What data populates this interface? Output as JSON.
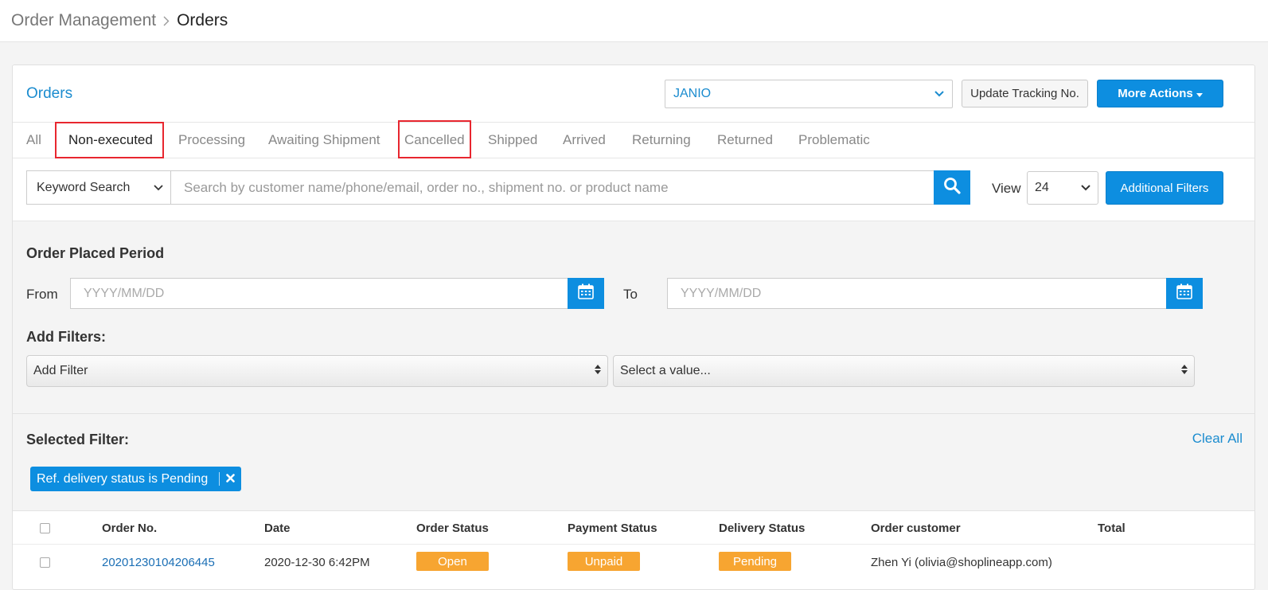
{
  "breadcrumb": {
    "root": "Order Management",
    "current": "Orders"
  },
  "panel": {
    "title": "Orders",
    "carrier_value": "JANIO",
    "update_tracking_label": "Update Tracking No.",
    "more_actions_label": "More Actions"
  },
  "tabs": [
    {
      "label": "All"
    },
    {
      "label": "Non-executed"
    },
    {
      "label": "Processing"
    },
    {
      "label": "Awaiting Shipment"
    },
    {
      "label": "Cancelled"
    },
    {
      "label": "Shipped"
    },
    {
      "label": "Arrived"
    },
    {
      "label": "Returning"
    },
    {
      "label": "Returned"
    },
    {
      "label": "Problematic"
    }
  ],
  "search": {
    "type_value": "Keyword Search",
    "placeholder": "Search by customer name/phone/email, order no., shipment no. or product name",
    "view_label": "View",
    "view_value": "24",
    "additional_filters_label": "Additional Filters"
  },
  "period": {
    "title": "Order Placed Period",
    "from_label": "From",
    "to_label": "To",
    "date_placeholder": "YYYY/MM/DD"
  },
  "add_filters": {
    "title": "Add Filters:",
    "filter_value": "Add Filter",
    "value_value": "Select a value..."
  },
  "selected_filter": {
    "title": "Selected Filter:",
    "clear_all_label": "Clear All",
    "chip_label": "Ref. delivery status is Pending"
  },
  "table": {
    "headers": [
      "Order No.",
      "Date",
      "Order Status",
      "Payment Status",
      "Delivery Status",
      "Order customer",
      "Total"
    ],
    "rows": [
      {
        "order_no": "20201230104206445",
        "date": "2020-12-30 6:42PM",
        "order_status": "Open",
        "payment_status": "Unpaid",
        "delivery_status": "Pending",
        "customer": "Zhen Yi (olivia@shoplineapp.com)",
        "total": ""
      }
    ]
  },
  "colors": {
    "primary": "#0d8ee0",
    "link": "#1b8ccf",
    "badge": "#f7a531",
    "highlight": "#e8262f"
  }
}
